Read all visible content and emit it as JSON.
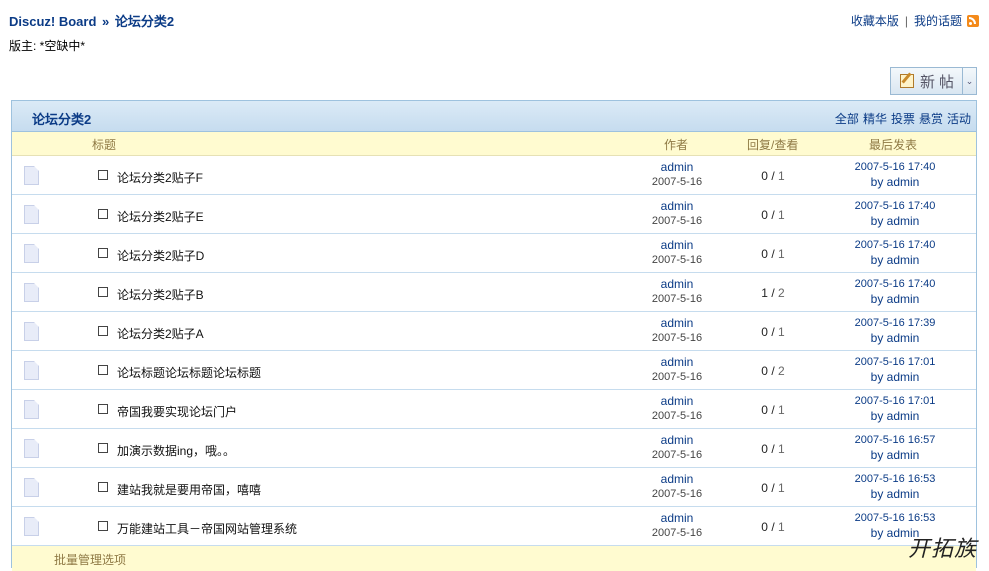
{
  "breadcrumb": {
    "home": "Discuz! Board",
    "separator": "»",
    "current": "论坛分类2"
  },
  "toplinks": {
    "favorite": "收藏本版",
    "my_topics": "我的话题",
    "rss_icon": "rss-icon"
  },
  "moderator": "版主: *空缺中*",
  "new_post": {
    "label": "新帖",
    "dropdown": "⌄"
  },
  "forum": {
    "title": "论坛分类2",
    "filters": [
      "全部",
      "精华",
      "投票",
      "悬赏",
      "活动"
    ]
  },
  "columns": {
    "subject": "标题",
    "author": "作者",
    "replies_views": "回复/查看",
    "last_post": "最后发表"
  },
  "threads": [
    {
      "subject": "论坛分类2贴子F",
      "author": "admin",
      "date": "2007-5-16",
      "replies": "0",
      "views": "1",
      "last_time": "2007-5-16 17:40",
      "last_by": "by admin"
    },
    {
      "subject": "论坛分类2贴子E",
      "author": "admin",
      "date": "2007-5-16",
      "replies": "0",
      "views": "1",
      "last_time": "2007-5-16 17:40",
      "last_by": "by admin"
    },
    {
      "subject": "论坛分类2贴子D",
      "author": "admin",
      "date": "2007-5-16",
      "replies": "0",
      "views": "1",
      "last_time": "2007-5-16 17:40",
      "last_by": "by admin"
    },
    {
      "subject": "论坛分类2贴子B",
      "author": "admin",
      "date": "2007-5-16",
      "replies": "1",
      "views": "2",
      "last_time": "2007-5-16 17:40",
      "last_by": "by admin"
    },
    {
      "subject": "论坛分类2贴子A",
      "author": "admin",
      "date": "2007-5-16",
      "replies": "0",
      "views": "1",
      "last_time": "2007-5-16 17:39",
      "last_by": "by admin"
    },
    {
      "subject": "论坛标题论坛标题论坛标题",
      "author": "admin",
      "date": "2007-5-16",
      "replies": "0",
      "views": "2",
      "last_time": "2007-5-16 17:01",
      "last_by": "by admin"
    },
    {
      "subject": "帝国我要实现论坛门户",
      "author": "admin",
      "date": "2007-5-16",
      "replies": "0",
      "views": "1",
      "last_time": "2007-5-16 17:01",
      "last_by": "by admin"
    },
    {
      "subject": "加演示数据ing，哦。。",
      "author": "admin",
      "date": "2007-5-16",
      "replies": "0",
      "views": "1",
      "last_time": "2007-5-16 16:57",
      "last_by": "by admin"
    },
    {
      "subject": "建站我就是要用帝国，嘻嘻",
      "author": "admin",
      "date": "2007-5-16",
      "replies": "0",
      "views": "1",
      "last_time": "2007-5-16 16:53",
      "last_by": "by admin"
    },
    {
      "subject": "万能建站工具－帝国网站管理系统",
      "author": "admin",
      "date": "2007-5-16",
      "replies": "0",
      "views": "1",
      "last_time": "2007-5-16 16:53",
      "last_by": "by admin"
    }
  ],
  "footer": {
    "batch_manage": "批量管理选项"
  },
  "watermark": "开拓族"
}
